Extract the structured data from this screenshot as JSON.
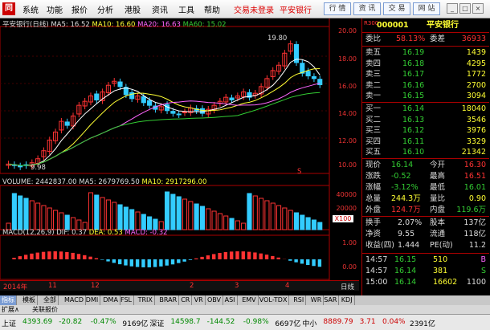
{
  "menu": {
    "logo": "同",
    "items": [
      "系统",
      "功能",
      "报价",
      "分析",
      "港股",
      "资讯",
      "工具",
      "帮助"
    ],
    "login": "交易未登录",
    "broker": "平安银行",
    "buttons": [
      "行 情",
      "资 讯",
      "交 易",
      "网 站"
    ]
  },
  "chart": {
    "title": "平安银行(日线)",
    "ma5": "MA5: 16.52",
    "ma10": "MA10: 16.60",
    "ma20": "MA20: 16.63",
    "ma60": "MA60: 15.02",
    "high_label": "19.80",
    "low_label": "9.98",
    "s_marker": "S",
    "price_axis": [
      "20.00",
      "18.00",
      "16.00",
      "14.00",
      "12.00",
      "10.00"
    ],
    "volume": "VOLUME: 2442837.00",
    "vma5": "MA5: 2679769.50",
    "vma10": "MA10: 2917296.00",
    "vol_axis": [
      "40000",
      "20000"
    ],
    "vol_unit": "X100",
    "macd": "MACD(12,26,9)",
    "dif": "DIF: 0.37",
    "dea": "DEA: 0.53",
    "macdv": "MACD: -0.32",
    "macd_axis": [
      "1.00",
      "0.00"
    ],
    "date_axis": [
      "2014年",
      "11",
      "12",
      "2",
      "3",
      "4"
    ],
    "period": "日线"
  },
  "quote": {
    "code_label": "R300",
    "code": "000001",
    "name": "平安银行",
    "weibi_label": "委比",
    "weibi": "58.13%",
    "weicha_label": "委差",
    "weicha": "36933",
    "asks": [
      {
        "label": "卖五",
        "price": "16.19",
        "vol": "1439"
      },
      {
        "label": "卖四",
        "price": "16.18",
        "vol": "4295"
      },
      {
        "label": "卖三",
        "price": "16.17",
        "vol": "1772"
      },
      {
        "label": "卖二",
        "price": "16.16",
        "vol": "2700"
      },
      {
        "label": "卖一",
        "price": "16.15",
        "vol": "3094"
      }
    ],
    "bids": [
      {
        "label": "买一",
        "price": "16.14",
        "vol": "18040"
      },
      {
        "label": "买二",
        "price": "16.13",
        "vol": "3546"
      },
      {
        "label": "买三",
        "price": "16.12",
        "vol": "3976"
      },
      {
        "label": "买四",
        "price": "16.11",
        "vol": "3329"
      },
      {
        "label": "买五",
        "price": "16.10",
        "vol": "21342"
      }
    ],
    "stats": [
      {
        "l1": "现价",
        "v1": "16.14",
        "c1": "g",
        "l2": "今开",
        "v2": "16.30",
        "c2": "r"
      },
      {
        "l1": "涨跌",
        "v1": "-0.52",
        "c1": "g",
        "l2": "最高",
        "v2": "16.51",
        "c2": "r"
      },
      {
        "l1": "涨幅",
        "v1": "-3.12%",
        "c1": "g",
        "l2": "最低",
        "v2": "16.01",
        "c2": "g"
      },
      {
        "l1": "总量",
        "v1": "244.3万",
        "c1": "y",
        "l2": "量比",
        "v2": "0.90",
        "c2": "y"
      },
      {
        "l1": "外盘",
        "v1": "124.7万",
        "c1": "r",
        "l2": "内盘",
        "v2": "119.6万",
        "c2": "g"
      }
    ],
    "fin": [
      {
        "l1": "换手",
        "v1": "2.07%",
        "l2": "股本",
        "v2": "137亿"
      },
      {
        "l1": "净资",
        "v1": "9.55",
        "l2": "流通",
        "v2": "118亿"
      },
      {
        "l1": "收益(四)",
        "v1": "1.444",
        "l2": "PE(动)",
        "v2": "11.2"
      }
    ],
    "ticks": [
      {
        "t": "14:57",
        "p": "16.15",
        "v": "510",
        "f": "B",
        "pc": "g",
        "fc": "m2"
      },
      {
        "t": "14:57",
        "p": "16.14",
        "v": "381",
        "f": "S",
        "pc": "g",
        "fc": "g"
      },
      {
        "t": "15:00",
        "p": "16.14",
        "v": "16602",
        "f": "1100",
        "pc": "g",
        "fc": "w"
      }
    ]
  },
  "tabs": [
    "指标",
    "模板",
    "全部",
    "MACD",
    "DMI",
    "DMA",
    "FSL",
    "TRIX",
    "BRAR",
    "CR",
    "VR",
    "OBV",
    "ASI",
    "EMV",
    "VOL-TDX",
    "RSI",
    "WR",
    "SAR",
    "KDJ"
  ],
  "tabs2": [
    "扩展∧",
    "关联报价"
  ],
  "status": [
    {
      "t": "上证",
      "c": "k"
    },
    {
      "t": "4393.69",
      "c": "g"
    },
    {
      "t": "-20.82",
      "c": "g"
    },
    {
      "t": "-0.47%",
      "c": "g"
    },
    {
      "t": "9169亿",
      "c": "k"
    },
    {
      "t": "深证",
      "c": "k"
    },
    {
      "t": "14598.7",
      "c": "g"
    },
    {
      "t": "-144.52",
      "c": "g"
    },
    {
      "t": "-0.98%",
      "c": "g"
    },
    {
      "t": "6697亿",
      "c": "k"
    },
    {
      "t": "中小",
      "c": "k"
    },
    {
      "t": "8889.79",
      "c": "r"
    },
    {
      "t": "3.71",
      "c": "r"
    },
    {
      "t": "0.04%",
      "c": "r"
    },
    {
      "t": "2391亿",
      "c": "k"
    }
  ],
  "chart_data": {
    "type": "candlestick",
    "ma_values": {
      "MA5": 16.52,
      "MA10": 16.6,
      "MA20": 16.63,
      "MA60": 15.02
    },
    "price_range": [
      9.5,
      20.5
    ],
    "close_series": [
      10.2,
      10.1,
      10.0,
      10.1,
      10.3,
      10.6,
      11.2,
      12.0,
      12.6,
      13.4,
      13.1,
      13.8,
      14.6,
      14.9,
      15.3,
      15.0,
      15.6,
      16.1,
      16.4,
      16.0,
      15.4,
      15.1,
      15.3,
      14.8,
      14.6,
      14.3,
      14.5,
      14.2,
      14.0,
      13.9,
      14.1,
      14.4,
      14.2,
      14.0,
      14.3,
      14.6,
      14.9,
      15.2,
      15.0,
      15.3,
      15.6,
      15.2,
      15.5,
      16.0,
      16.6,
      17.2,
      17.6,
      18.5,
      19.2,
      17.8,
      17.0,
      16.8,
      16.6,
      16.14
    ]
  }
}
